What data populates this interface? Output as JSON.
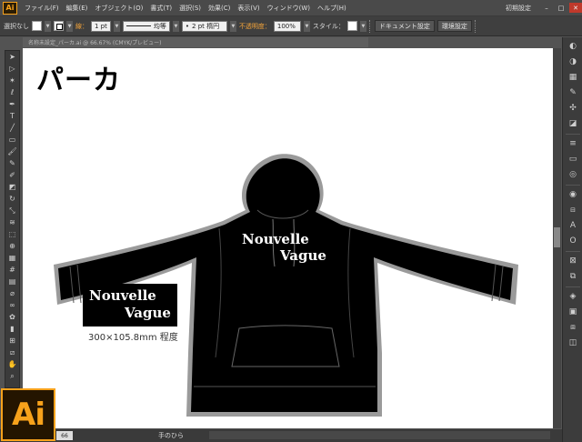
{
  "app": {
    "badge": "Ai",
    "big_logo": "Ai"
  },
  "menu": [
    "ファイル(F)",
    "編集(E)",
    "オブジェクト(O)",
    "書式(T)",
    "選択(S)",
    "効果(C)",
    "表示(V)",
    "ウィンドウ(W)",
    "ヘルプ(H)"
  ],
  "workspace_label": "初期設定",
  "control": {
    "selection": "選択なし",
    "stroke_label": "線：",
    "stroke_weight": "1 pt",
    "profile": "均等",
    "brush": "2 pt 楕円",
    "opacity_label": "不透明度：",
    "opacity_value": "100%",
    "style_label": "スタイル：",
    "doc_settings": "ドキュメント設定",
    "prefs": "環境設定"
  },
  "doc_tab": "名称未設定_パーカ.ai @ 66.67% (CMYK/プレビュー)",
  "canvas": {
    "title": "パーカ",
    "logo_line1": "Nouvelle",
    "logo_line2": "Vague",
    "dimensions": "300×105.8mm 程度",
    "print_line1": "Nouvelle",
    "print_line2": "Vague"
  },
  "status": {
    "zoom": "66",
    "tool": "手のひら"
  },
  "tools": [
    "selection-arrow",
    "direct-select",
    "magic-wand",
    "lasso",
    "pen",
    "type",
    "line",
    "rectangle",
    "paintbrush",
    "pencil",
    "blob-brush",
    "eraser",
    "rotate",
    "scale",
    "warp",
    "free-transform",
    "shape-builder",
    "perspective",
    "mesh",
    "gradient",
    "eyedropper",
    "blend",
    "symbol-sprayer",
    "column-graph",
    "artboard",
    "slice",
    "hand",
    "zoom"
  ],
  "panel_icons": [
    "color",
    "color-guide",
    "swatches",
    "brushes",
    "symbols",
    "graphic-styles",
    "stroke",
    "gradient",
    "transparency",
    "appearance",
    "align",
    "character",
    "layers",
    "artboards",
    "links",
    "navigator"
  ]
}
